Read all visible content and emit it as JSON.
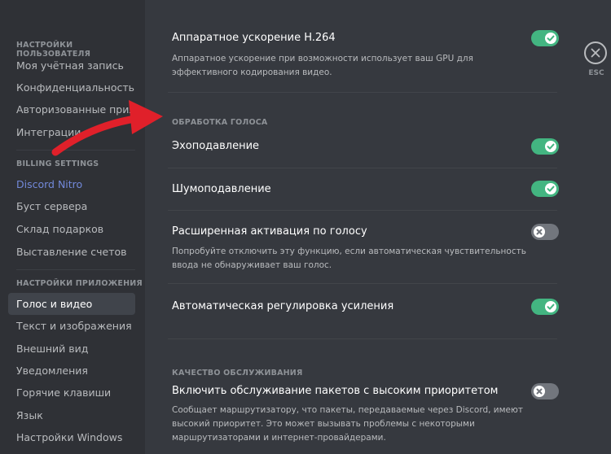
{
  "sidebar": {
    "user_settings_header": "НАСТРОЙКИ ПОЛЬЗОВАТЕЛЯ",
    "user_items": [
      {
        "label": "Моя учётная запись"
      },
      {
        "label": "Конфиденциальность"
      },
      {
        "label": "Авторизованные прил..."
      },
      {
        "label": "Интеграции"
      }
    ],
    "billing_header": "BILLING SETTINGS",
    "billing_items": [
      {
        "label": "Discord Nitro"
      },
      {
        "label": "Буст сервера"
      },
      {
        "label": "Склад подарков"
      },
      {
        "label": "Выставление счетов"
      }
    ],
    "app_header": "НАСТРОЙКИ ПРИЛОЖЕНИЯ",
    "app_items": [
      {
        "label": "Голос и видео"
      },
      {
        "label": "Текст и изображения"
      },
      {
        "label": "Внешний вид"
      },
      {
        "label": "Уведомления"
      },
      {
        "label": "Горячие клавиши"
      },
      {
        "label": "Язык"
      },
      {
        "label": "Настройки Windows"
      }
    ]
  },
  "main": {
    "h264": {
      "title": "Аппаратное ускорение H.264",
      "desc": "Аппаратное ускорение при возможности использует ваш GPU для эффективного кодирования видео.",
      "enabled": true
    },
    "voice_processing_header": "ОБРАБОТКА ГОЛОСА",
    "echo": {
      "title": "Эхоподавление",
      "enabled": true
    },
    "noise": {
      "title": "Шумоподавление",
      "enabled": true
    },
    "advanced_vad": {
      "title": "Расширенная активация по голосу",
      "desc": "Попробуйте отключить эту функцию, если автоматическая чувствительность ввода не обнаруживает ваш голос.",
      "enabled": false
    },
    "agc": {
      "title": "Автоматическая регулировка усиления",
      "enabled": true
    },
    "qos_header": "КАЧЕСТВО ОБСЛУЖИВАНИЯ",
    "qos": {
      "title": "Включить обслуживание пакетов с высоким приоритетом",
      "desc": "Сообщает маршрутизатору, что пакеты, передаваемые через Discord, имеют высокий приоритет. Это может вызывать проблемы с некоторыми маршрутизаторами и интернет-провайдерами.",
      "enabled": false
    }
  },
  "close": {
    "label": "ESC"
  },
  "colors": {
    "background": "#36393f",
    "sidebar": "#2f3136",
    "toggle_on": "#43b581",
    "toggle_off": "#72767d",
    "nitro": "#7289da",
    "annotation_arrow": "#e0202a"
  },
  "icons": {
    "close": "close-icon",
    "check": "check-icon",
    "x_mark": "x-mark-icon",
    "annotation": "red-arrow-annotation"
  }
}
